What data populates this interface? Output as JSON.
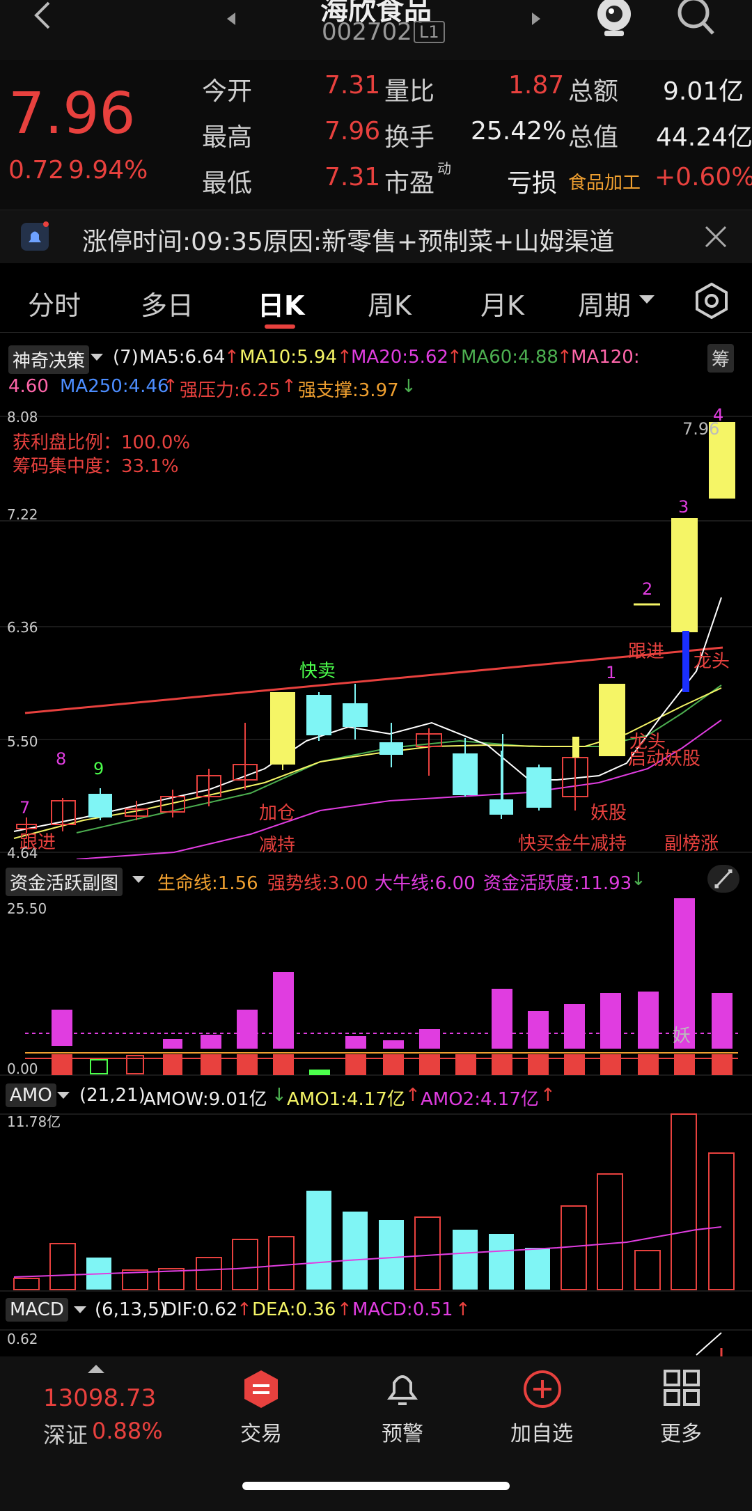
{
  "header": {
    "title": "海欣食品",
    "code": "002702",
    "level": "L1"
  },
  "quote": {
    "price": "7.96",
    "change": "0.72",
    "change_pct": "9.94%",
    "row1": {
      "l1": "今开",
      "v1": "7.31",
      "l2": "量比",
      "v2": "1.87",
      "l3": "总额",
      "v3": "9.01亿"
    },
    "row2": {
      "l1": "最高",
      "v1": "7.96",
      "l2": "换手",
      "v2": "25.42%",
      "l3": "总值",
      "v3": "44.24亿"
    },
    "row3": {
      "l1": "最低",
      "v1": "7.31",
      "l2": "市盈",
      "sup": "动",
      "v2": "亏损",
      "l3": "食品加工",
      "v3": "+0.60%"
    }
  },
  "notice": {
    "text": "涨停时间:09:35原因:新零售+预制菜+山姆渠道"
  },
  "tabs": [
    "分时",
    "多日",
    "日K",
    "周K",
    "月K",
    "周期"
  ],
  "main_legend": {
    "indicator": "神奇决策",
    "param": "(7)",
    "ma5": "MA5:6.64",
    "ma10": "MA10:5.94",
    "ma20": "MA20:5.62",
    "ma60": "MA60:4.88",
    "ma120": "MA120:",
    "ma120v": "4.60",
    "ma250": "MA250:4.46",
    "press": "强压力:6.25",
    "support": "强支撑:3.97",
    "side_btn": "筹"
  },
  "main_chart": {
    "y_labels": [
      "8.08",
      "7.22",
      "6.36",
      "5.50",
      "4.64"
    ],
    "info1": "获利盘比例：100.0%",
    "info2": "筹码集中度：33.1%",
    "last_price": "7.96",
    "annotations": {
      "kuaimai": "快卖",
      "gen1": "跟进",
      "jiacang": "加仓",
      "d1": "减持",
      "d2": "减持",
      "d3": "快买金牛减持",
      "yaogu1": "妖股",
      "gen2": "跟进",
      "longtou1": "龙头",
      "longtou2": "龙头",
      "qidong": "启动妖股",
      "rally": "副榜涨",
      "n7": "7",
      "n8": "8",
      "n9": "9",
      "n1": "1",
      "n2": "2",
      "n3": "3",
      "n4": "4"
    }
  },
  "fund_legend": {
    "name": "资金活跃副图",
    "life": "生命线:1.56",
    "strong": "强势线:3.00",
    "bull": "大牛线:6.00",
    "active": "资金活跃度:11.93"
  },
  "fund_chart": {
    "top": "25.50",
    "bottom": "0.00",
    "tag": "妖"
  },
  "amo_legend": {
    "name": "AMO",
    "param": "(21,21)",
    "amow": "AMOW:9.01亿",
    "amo1": "AMO1:4.17亿",
    "amo2": "AMO2:4.17亿"
  },
  "amo_chart": {
    "top": "11.78亿"
  },
  "macd_legend": {
    "name": "MACD",
    "param": "(6,13,5)",
    "dif": "DIF:0.62",
    "dea": "DEA:0.36",
    "macd": "MACD:0.51"
  },
  "macd_chart": {
    "top": "0.62"
  },
  "bottom": {
    "index_value": "13098.73",
    "index_name": "深证",
    "index_pct": "0.88%",
    "nav": [
      "交易",
      "预警",
      "加自选",
      "更多"
    ]
  },
  "colors": {
    "up": "#e8413e",
    "down": "#7ff5f5",
    "yellow": "#f5f566",
    "magenta": "#e03de0",
    "green": "#4caf50"
  }
}
